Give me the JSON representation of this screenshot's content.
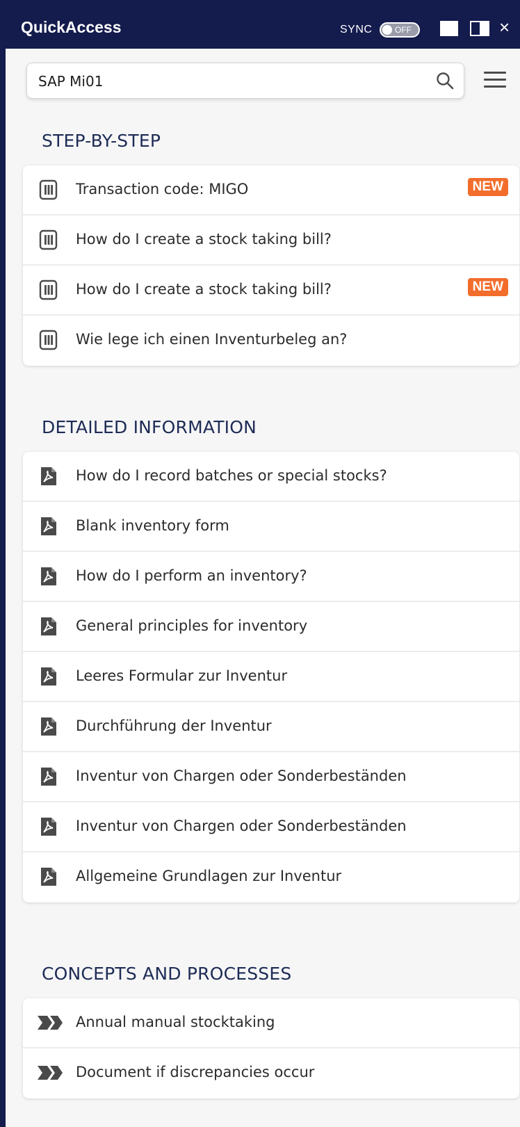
{
  "app": {
    "title": "QuickAccess"
  },
  "header": {
    "sync_label": "SYNC",
    "sync_state": "OFF",
    "close_glyph": "×"
  },
  "search": {
    "value": "SAP Mi01"
  },
  "sections": {
    "step_by_step": {
      "title": "STEP-BY-STEP",
      "icon": "manual-doc-icon",
      "items": [
        {
          "label": "Transaction code: MIGO",
          "badge": "NEW"
        },
        {
          "label": "How do I create a stock taking bill?",
          "badge": ""
        },
        {
          "label": "How do I create a stock taking bill?",
          "badge": "NEW"
        },
        {
          "label": "Wie lege ich einen Inventurbeleg an?",
          "badge": ""
        }
      ]
    },
    "detailed_information": {
      "title": "DETAILED INFORMATION",
      "icon": "pdf-icon",
      "items": [
        {
          "label": "How do I record batches or special stocks?"
        },
        {
          "label": "Blank inventory form"
        },
        {
          "label": "How do I perform an inventory?"
        },
        {
          "label": "General principles for inventory"
        },
        {
          "label": "Leeres Formular zur Inventur"
        },
        {
          "label": "Durchführung der Inventur"
        },
        {
          "label": "Inventur von Chargen oder Sonderbeständen"
        },
        {
          "label": "Inventur von Chargen oder Sonderbeständen"
        },
        {
          "label": "Allgemeine Grundlagen zur Inventur"
        }
      ]
    },
    "concepts": {
      "title": "CONCEPTS AND PROCESSES",
      "icon": "process-arrows-icon",
      "items": [
        {
          "label": "Annual manual stocktaking"
        },
        {
          "label": "Document if discrepancies occur"
        }
      ]
    }
  },
  "colors": {
    "titlebar": "#141b4d",
    "badge": "#f26d2c",
    "section_title": "#1e2c55"
  }
}
